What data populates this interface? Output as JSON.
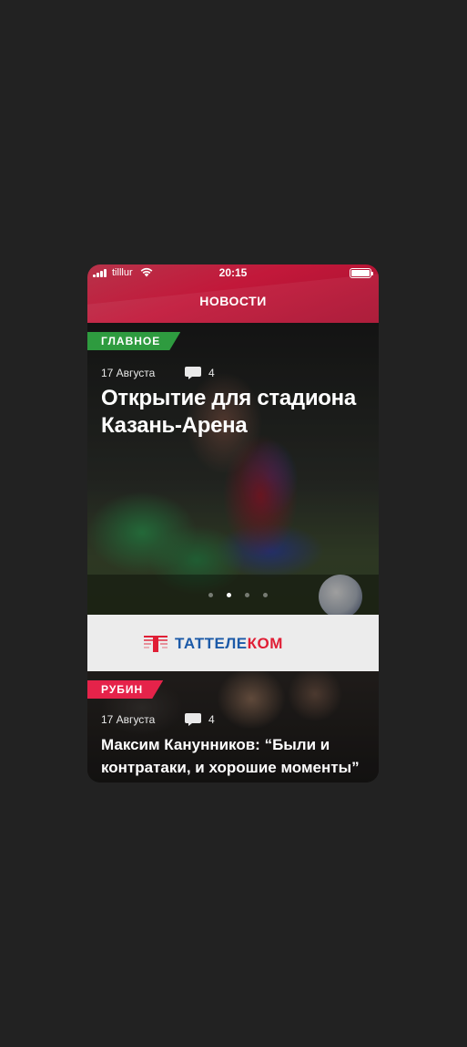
{
  "status_bar": {
    "carrier": "tilllur",
    "time": "20:15",
    "wifi_icon": "wifi-icon",
    "battery_icon": "battery-icon"
  },
  "header": {
    "title": "НОВОСТИ"
  },
  "carousel": {
    "active_page": 2,
    "page_count": 4
  },
  "featured": {
    "tag": "ГЛАВНОЕ",
    "tag_color": "#2e9b3f",
    "date": "17 Августа",
    "comments": "4",
    "title": "Открытие для стадиона Казань-Арена"
  },
  "ad": {
    "brand_part1": "ТАТТЕЛЕ",
    "brand_part2": "КОМ"
  },
  "second": {
    "tag": "РУБИН",
    "tag_color": "#e5234a",
    "date": "17 Августа",
    "comments": "4",
    "title": "Максим Канунников: “Были и контратаки, и хорошие моменты”"
  },
  "colors": {
    "background": "#222222",
    "header_red": "#c2183a",
    "ad_blue": "#1c5aa8",
    "ad_red": "#e01e35"
  }
}
